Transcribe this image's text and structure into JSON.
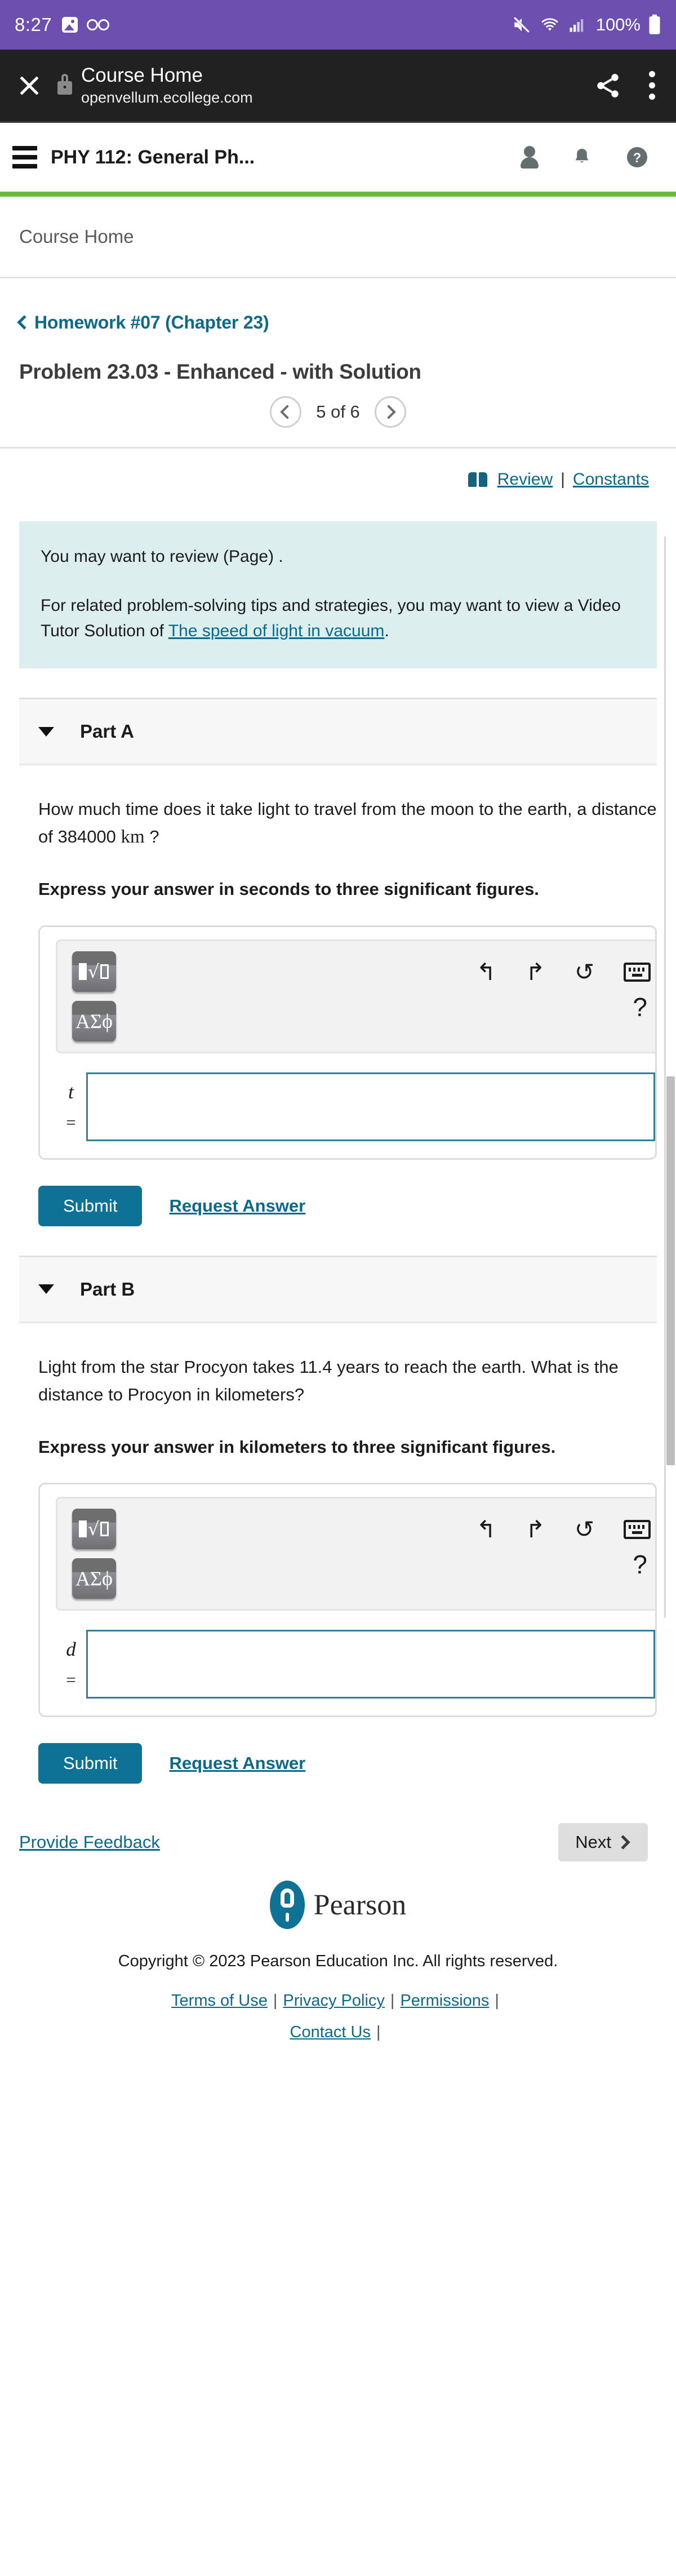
{
  "status_bar": {
    "time": "8:27",
    "battery_percent": "100%",
    "icons": [
      "image-thumbnail-icon",
      "voicemail-icon",
      "mute-icon",
      "wifi-icon",
      "signal-icon",
      "battery-icon"
    ]
  },
  "browser_bar": {
    "title": "Course Home",
    "url": "openvellum.ecollege.com",
    "close_label": "×",
    "share_label": "share",
    "menu_label": "more"
  },
  "app_bar": {
    "course_title": "PHY 112: General Ph...",
    "icons": [
      "account-icon",
      "notifications-icon",
      "help-icon"
    ]
  },
  "breadcrumb": {
    "label": "Course Home"
  },
  "problem_header": {
    "assignment_link": "Homework #07 (Chapter 23)",
    "title": "Problem 23.03 - Enhanced - with Solution",
    "pager_label": "5 of 6",
    "prev_label": "Previous problem",
    "next_label": "Next problem"
  },
  "toolbar": {
    "review_label": "Review",
    "separator": "|",
    "constants_label": "Constants"
  },
  "info_box": {
    "line1": "You may want to review (Page) .",
    "line2_prefix": "For related problem-solving tips and strategies, you may want to view a Video Tutor Solution of ",
    "line2_link": "The speed of light in vacuum",
    "line2_suffix": "."
  },
  "parts": [
    {
      "label": "Part A",
      "question_prefix": "How much time does it take light to travel from the moon to the earth, a distance of 384000 ",
      "question_unit": "km",
      "question_suffix": " ?",
      "instruction": "Express your answer in seconds to three significant figures.",
      "variable": "t",
      "equals": "=",
      "answer_value": "",
      "submit_label": "Submit",
      "request_answer_label": "Request Answer",
      "toolbar_icons": [
        "undo-icon",
        "redo-icon",
        "reset-icon",
        "keyboard-icon",
        "help-icon"
      ],
      "template_button_label": "math-template-icon",
      "greek_button_label": "ΑΣϕ",
      "undo_glyph": "↰",
      "redo_glyph": "↱",
      "reset_glyph": "↺",
      "help_glyph": "?"
    },
    {
      "label": "Part B",
      "question_prefix": "Light from the star Procyon takes 11.4 years to reach the earth. What is the distance to Procyon in kilometers?",
      "question_unit": "",
      "question_suffix": "",
      "instruction": "Express your answer in kilometers to three significant figures.",
      "variable": "d",
      "equals": "=",
      "answer_value": "",
      "submit_label": "Submit",
      "request_answer_label": "Request Answer",
      "toolbar_icons": [
        "undo-icon",
        "redo-icon",
        "reset-icon",
        "keyboard-icon",
        "help-icon"
      ],
      "template_button_label": "math-template-icon",
      "greek_button_label": "ΑΣϕ",
      "undo_glyph": "↰",
      "redo_glyph": "↱",
      "reset_glyph": "↺",
      "help_glyph": "?"
    }
  ],
  "footer": {
    "feedback_label": "Provide Feedback",
    "next_label": "Next",
    "brand": "Pearson",
    "copyright": "Copyright © 2023 Pearson Education Inc. All rights reserved.",
    "links": [
      "Terms of Use",
      "Privacy Policy",
      "Permissions",
      "Contact Us"
    ],
    "link_separator": "|"
  },
  "colors": {
    "status_bar": "#6d4fb0",
    "browser_bar": "#212121",
    "accent_green": "#6aba3d",
    "link_teal": "#0b6a8a",
    "submit_teal": "#0d7295",
    "info_bg": "#ddeeef"
  }
}
